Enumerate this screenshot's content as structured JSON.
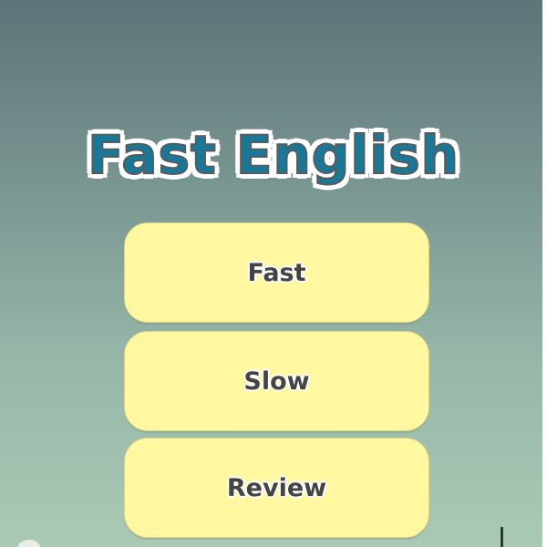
{
  "app": {
    "title": "Fast English"
  },
  "menu": {
    "fast_label": "Fast",
    "slow_label": "Slow",
    "review_label": "Review"
  },
  "colors": {
    "title_fill": "#17799a",
    "button_fill": "#fff8a0",
    "background_top": "#5d7478",
    "background_bottom": "#aac9b5"
  }
}
